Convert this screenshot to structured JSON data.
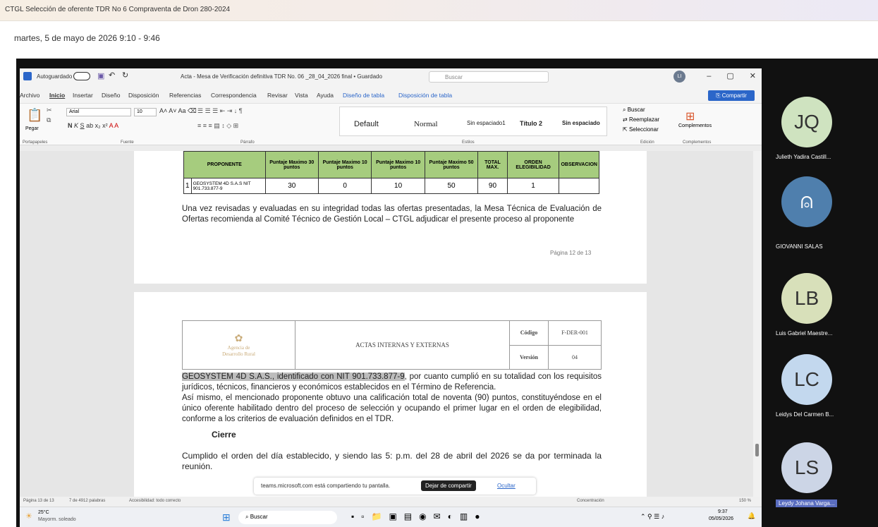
{
  "meeting": {
    "title": "CTGL Selección de oferente TDR No 6 Compraventa de Dron 280-2024",
    "datetime": "martes, 5 de mayo de 2026 9:10 - 9:46"
  },
  "word": {
    "autosave_label": "Autoguardado",
    "doc_title": "Acta - Mesa de Verificación definitiva TDR No. 06 _28_04_2026 final • Guardado",
    "search_placeholder": "Buscar",
    "user_initial": "LI",
    "menu": [
      "Archivo",
      "Inicio",
      "Insertar",
      "Diseño",
      "Disposición",
      "Referencias",
      "Correspondencia",
      "Revisar",
      "Vista",
      "Ayuda",
      "Diseño de tabla",
      "Disposición de tabla"
    ],
    "share": "Compartir",
    "ribbon": {
      "paste": "Pegar",
      "font": "Arial",
      "size": "10",
      "styles": [
        "Default",
        "Normal",
        "Sin espaciado1",
        "Título 2",
        "Sin espaciado"
      ],
      "find": "Buscar",
      "replace": "Reemplazar",
      "select": "Seleccionar",
      "addins": "Complementos",
      "groups": [
        "Portapapeles",
        "Fuente",
        "Párrafo",
        "Estilos",
        "Edición",
        "Complementos"
      ]
    },
    "table": {
      "headers": [
        "PROPONENTE",
        "Puntaje Maximo 30 puntos",
        "Puntaje Maximo 10 puntos",
        "Puntaje Maximo 10 puntos",
        "Puntaje Maximo 50 puntos",
        "TOTAL MAX.",
        "ORDEN ELEGIBILIDAD",
        "OBSERVACION"
      ],
      "row": {
        "num": "1",
        "name": "GEOSYSTEM 4D S.A.S NIT 901.733.877-9",
        "values": [
          "30",
          "0",
          "10",
          "50",
          "90",
          "1",
          ""
        ]
      }
    },
    "para1": "Una vez revisadas y evaluadas en su integridad todas las ofertas presentadas, la Mesa Técnica de Evaluación de Ofertas recomienda al Comité Técnico de Gestión Local – CTGL adjudicar el presente proceso al proponente",
    "page_label": "Página 12 de 13",
    "header2": {
      "logo1": "Agencia de",
      "logo2": "Desarrollo Rural",
      "title": "ACTAS INTERNAS Y EXTERNAS",
      "code_label": "Código",
      "code_value": "F-DER-001",
      "version_label": "Versión",
      "version_value": "04"
    },
    "para2_highlight": "GEOSYSTEM 4D S.A.S., identificado con NIT 901.733.877-9",
    "para2_rest": ", por cuanto cumplió en su totalidad con los requisitos jurídicos, técnicos, financieros y económicos establecidos en el Término de Referencia.",
    "para3": "Así mismo, el mencionado proponente obtuvo una calificación total de noventa (90) puntos, constituyéndose en el único oferente habilitado dentro del proceso de selección y ocupando el primer lugar en el orden de elegibilidad, conforme a los criterios de evaluación definidos en el TDR.",
    "closing_title": "Cierre",
    "para4": "Cumplido el orden del día establecido, y siendo las 5: p.m. del 28 de abril del 2026 se da por terminada la reunión.",
    "statusbar": {
      "page": "Página 13 de 13",
      "words": "7 de 4912 palabras",
      "access": "Accesibilidad: todo correcto",
      "focus": "Concentración",
      "zoom": "150 %"
    }
  },
  "sharebar": {
    "text": "teams.microsoft.com está compartiendo tu pantalla.",
    "stop": "Dejar de compartir",
    "hide": "Ocultar"
  },
  "taskbar": {
    "weather": "25°C",
    "weather_desc": "Mayorm. soleado",
    "search": "Buscar",
    "time": "9:37",
    "date": "05/05/2026"
  },
  "participants": [
    {
      "initials": "JQ",
      "name": "Julieth Yadira Castill...",
      "color": "#cfe3c0"
    },
    {
      "initials": "",
      "name": "GIOVANNI SALAS",
      "color": "#4f7fad",
      "icon": "person-icon"
    },
    {
      "initials": "LB",
      "name": "Luis Gabriel Maestre...",
      "color": "#d8e0ba"
    },
    {
      "initials": "LC",
      "name": "Leidys Del Carmen B...",
      "color": "#c3d8ee"
    },
    {
      "initials": "LS",
      "name": "Leydy Johana Varga...",
      "color": "#ccd5e6"
    }
  ]
}
